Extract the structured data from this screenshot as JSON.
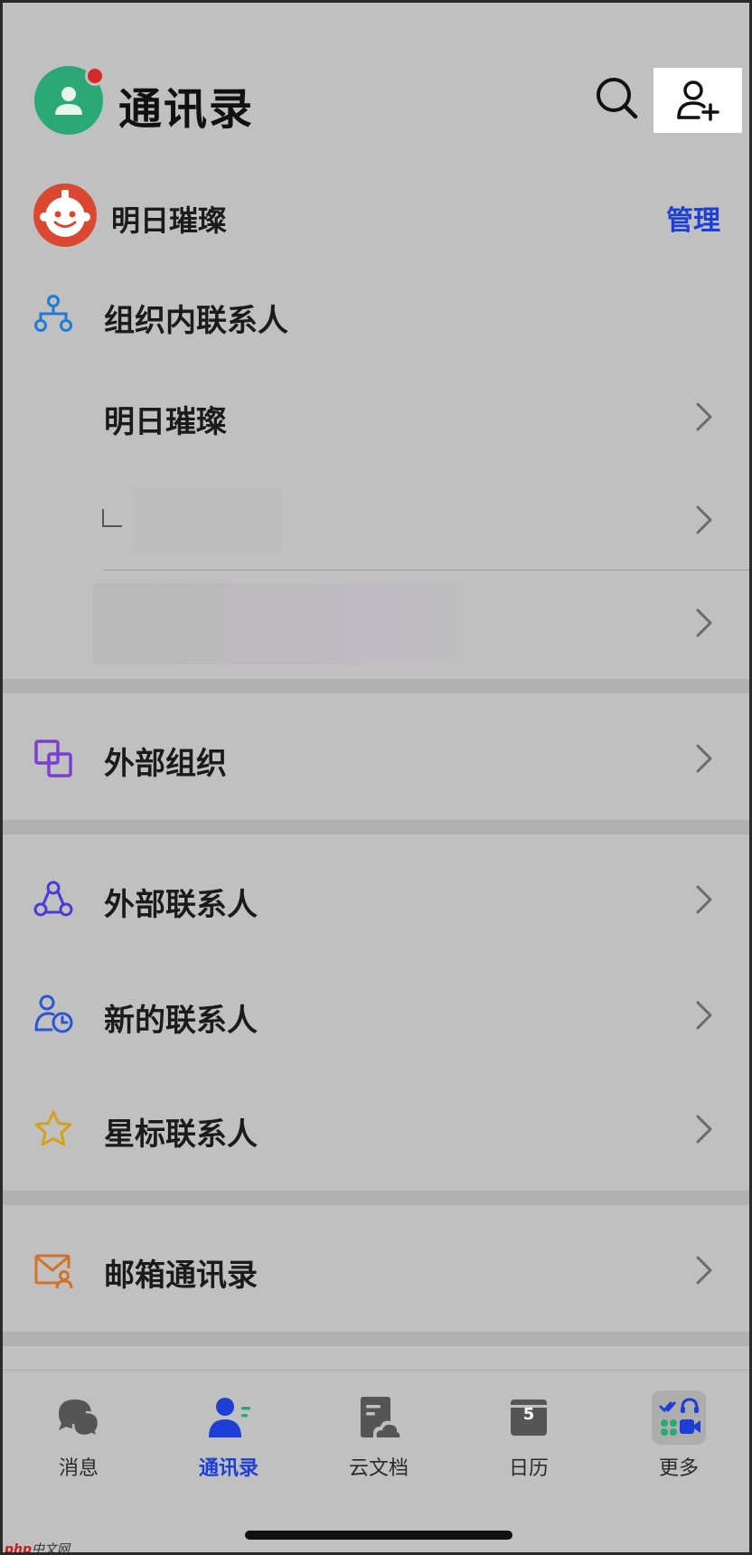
{
  "header": {
    "title": "通讯录",
    "search_icon": "search-icon",
    "add_icon": "add-contact-icon"
  },
  "org": {
    "name": "明日璀璨",
    "manage_label": "管理",
    "logo_color": "#d9482f"
  },
  "contacts": {
    "internal_label": "组织内联系人",
    "org_root_label": "明日璀璨",
    "external_org_label": "外部组织",
    "external_contacts_label": "外部联系人",
    "new_contacts_label": "新的联系人",
    "starred_contacts_label": "星标联系人",
    "mail_contacts_label": "邮箱通讯录"
  },
  "tabs": [
    {
      "label": "消息",
      "icon": "message-icon",
      "active": false
    },
    {
      "label": "通讯录",
      "icon": "contacts-icon",
      "active": true
    },
    {
      "label": "云文档",
      "icon": "cloud-doc-icon",
      "active": false
    },
    {
      "label": "日历",
      "icon": "calendar-icon",
      "active": false,
      "badge": "5"
    },
    {
      "label": "更多",
      "icon": "more-apps-icon",
      "active": false
    }
  ],
  "watermark": {
    "brand": "php",
    "suffix": "中文网"
  },
  "colors": {
    "accent": "#1d3fd6",
    "avatar_green": "#2aa876",
    "notification_red": "#d62929",
    "external_org_icon": "#7a3fd1",
    "external_contacts_icon": "#4a3ad6",
    "new_contacts_icon": "#2a55d6",
    "star_icon": "#d6a11a",
    "mail_icon": "#d0732a"
  }
}
